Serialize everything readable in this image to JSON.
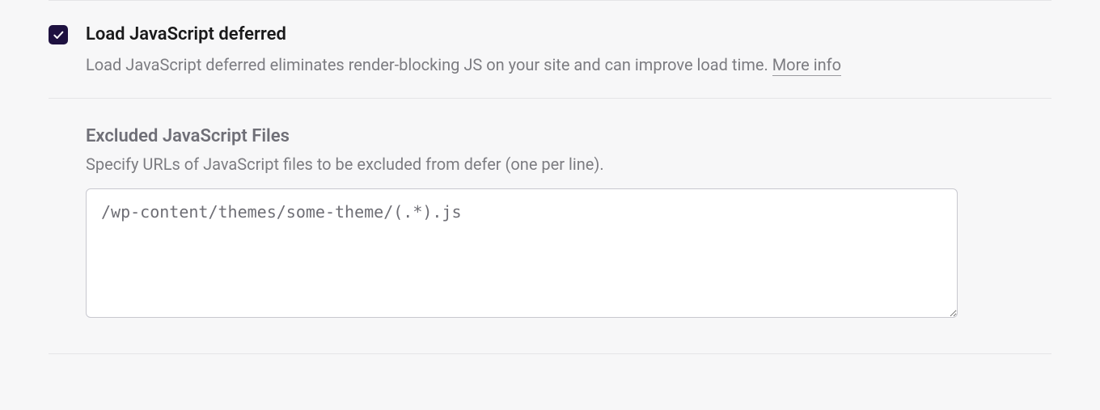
{
  "defer": {
    "checked": true,
    "title": "Load JavaScript deferred",
    "description": "Load JavaScript deferred eliminates render-blocking JS on your site and can improve load time. ",
    "more_info": "More info"
  },
  "exclude": {
    "title": "Excluded JavaScript Files",
    "description": "Specify URLs of JavaScript files to be excluded from defer (one per line).",
    "value": "/wp-content/themes/some-theme/(.*).js"
  }
}
